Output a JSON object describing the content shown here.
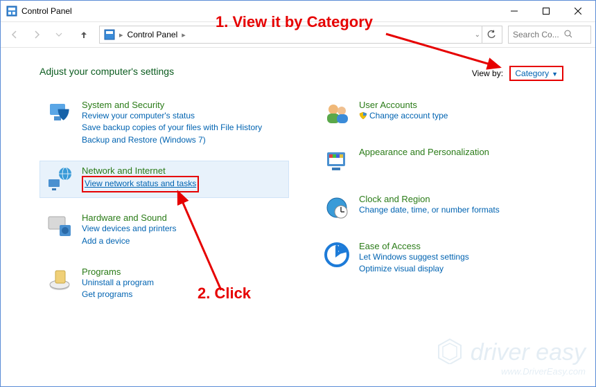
{
  "window": {
    "title": "Control Panel"
  },
  "address": {
    "location": "Control Panel"
  },
  "search": {
    "placeholder": "Search Co..."
  },
  "heading": "Adjust your computer's settings",
  "viewby": {
    "label": "View by:",
    "value": "Category"
  },
  "left": [
    {
      "name": "System and Security",
      "links": [
        "Review your computer's status",
        "Save backup copies of your files with File History",
        "Backup and Restore (Windows 7)"
      ]
    },
    {
      "name": "Network and Internet",
      "links": [
        "View network status and tasks"
      ]
    },
    {
      "name": "Hardware and Sound",
      "links": [
        "View devices and printers",
        "Add a device"
      ]
    },
    {
      "name": "Programs",
      "links": [
        "Uninstall a program",
        "Get programs"
      ]
    }
  ],
  "right": [
    {
      "name": "User Accounts",
      "links": [
        "Change account type"
      ],
      "shielded": [
        0
      ]
    },
    {
      "name": "Appearance and Personalization",
      "links": []
    },
    {
      "name": "Clock and Region",
      "links": [
        "Change date, time, or number formats"
      ]
    },
    {
      "name": "Ease of Access",
      "links": [
        "Let Windows suggest settings",
        "Optimize visual display"
      ]
    }
  ],
  "annotations": {
    "step1": "1. View it by Category",
    "step2": "2. Click"
  },
  "watermark": {
    "brand": "driver easy",
    "url": "www.DriverEasy.com"
  }
}
